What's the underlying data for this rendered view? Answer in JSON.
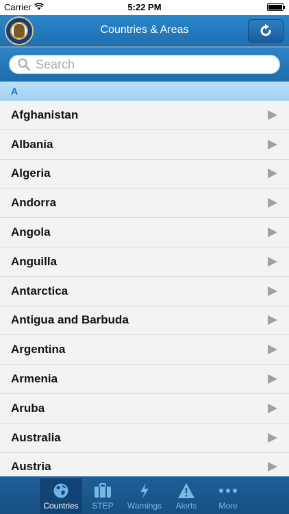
{
  "status": {
    "carrier": "Carrier",
    "time": "5:22 PM"
  },
  "nav": {
    "title": "Countries & Areas"
  },
  "search": {
    "placeholder": "Search"
  },
  "section": {
    "letter": "A"
  },
  "countries": [
    "Afghanistan",
    "Albania",
    "Algeria",
    "Andorra",
    "Angola",
    "Anguilla",
    "Antarctica",
    "Antigua and Barbuda",
    "Argentina",
    "Armenia",
    "Aruba",
    "Australia",
    "Austria"
  ],
  "tabs": [
    {
      "label": "Countries",
      "icon": "globe-icon",
      "active": true
    },
    {
      "label": "STEP",
      "icon": "suitcase-icon",
      "active": false
    },
    {
      "label": "Warnings",
      "icon": "lightning-icon",
      "active": false
    },
    {
      "label": "Alerts",
      "icon": "warning-triangle-icon",
      "active": false
    },
    {
      "label": "More",
      "icon": "more-dots-icon",
      "active": false
    }
  ],
  "colors": {
    "accent": "#1f6fb0",
    "section_text": "#1a6fc0",
    "chevron": "#a0a0a0"
  }
}
